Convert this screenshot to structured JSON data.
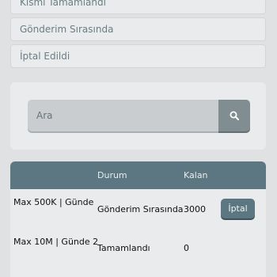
{
  "status_filters": [
    {
      "label": "Kısmi Tamamlandı"
    },
    {
      "label": "Gönderim Sırasında"
    },
    {
      "label": "İptal Edildi"
    }
  ],
  "search": {
    "placeholder": "Ara",
    "button_icon": "search-icon"
  },
  "table": {
    "headers": [
      "",
      "Durum",
      "Kalan",
      ""
    ],
    "rows": [
      {
        "service": "Max 500K | Günde",
        "status": "Gönderim Sırasında",
        "remaining": "3000",
        "action": "İptal"
      },
      {
        "service": "Max 10M | Günde 2",
        "status": "Tamamlandı",
        "remaining": "0",
        "action": ""
      }
    ]
  },
  "colors": {
    "background": "#dfe1e3",
    "panel": "#e9ebec",
    "accent": "#5c7781",
    "search_button": "#808d91",
    "filter_text": "#6b7e83"
  }
}
